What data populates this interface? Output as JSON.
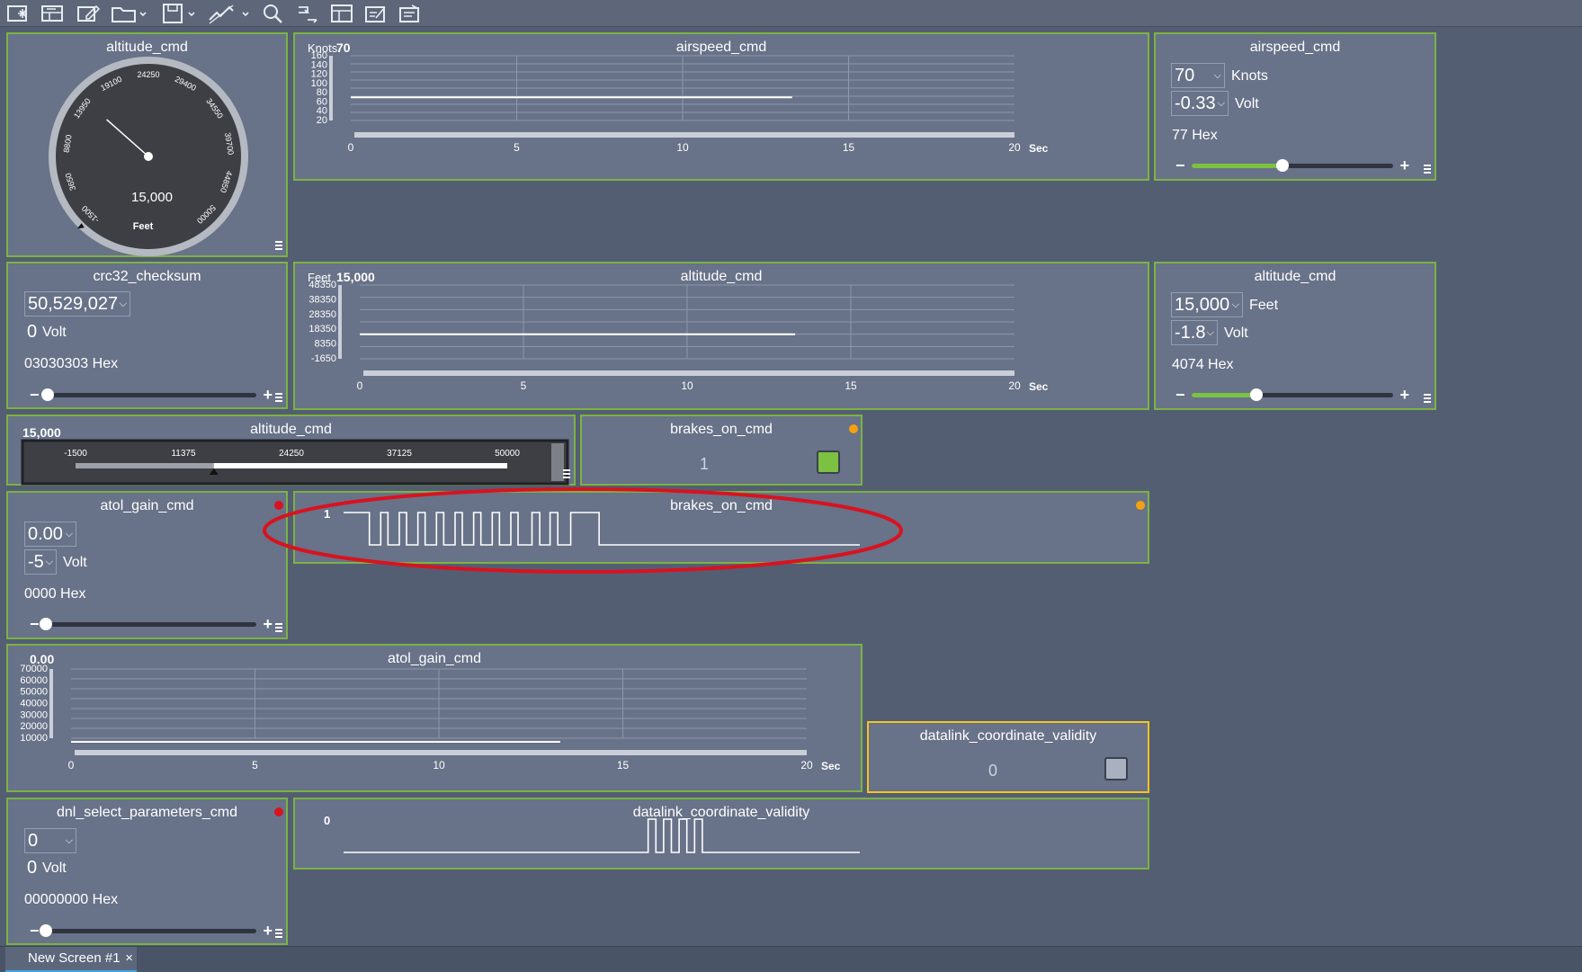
{
  "toolbar": {
    "icons": [
      "new-screen-icon",
      "layout-icon",
      "edit-icon",
      "open-folder-icon",
      "save-icon",
      "signal-icon",
      "search-icon",
      "transfer-icon",
      "table-icon",
      "script-icon",
      "export-icon"
    ]
  },
  "gauge": {
    "title": "altitude_cmd",
    "value_text": "15,000",
    "unit": "Feet",
    "min": -1500,
    "max": 50000,
    "value": 15000,
    "ticks": [
      "-1500",
      "3650",
      "8800",
      "13950",
      "19100",
      "24250",
      "29400",
      "34550",
      "39700",
      "44850",
      "50000"
    ]
  },
  "airspeed_chart": {
    "title": "airspeed_cmd",
    "unit": "Knots",
    "value": "70",
    "sec": "Sec"
  },
  "airspeed_ctrl": {
    "title": "airspeed_cmd",
    "value": "70",
    "unit": "Knots",
    "volt": "-0.33",
    "volt_unit": "Volt",
    "hex": "77 Hex",
    "slider": 0.45
  },
  "crc": {
    "title": "crc32_checksum",
    "value": "50,529,027",
    "volt": "0",
    "volt_unit": "Volt",
    "hex": "03030303 Hex",
    "slider": 0.01
  },
  "alt_chart": {
    "title": "altitude_cmd",
    "unit": "Feet",
    "value": "15,000",
    "sec": "Sec"
  },
  "alt_ctrl": {
    "title": "altitude_cmd",
    "value": "15,000",
    "unit": "Feet",
    "volt": "-1.8",
    "volt_unit": "Volt",
    "hex": "4074 Hex",
    "slider": 0.32
  },
  "alt_bar": {
    "title": "altitude_cmd",
    "value_text": "15,000",
    "min": -1500,
    "max": 50000,
    "value": 15000,
    "ticks": [
      "-1500",
      "11375",
      "24250",
      "37125",
      "50000"
    ]
  },
  "brakes_btn": {
    "title": "brakes_on_cmd",
    "value": "1",
    "led_color": "#7cc142",
    "dot_color": "#f3a10f"
  },
  "atol_ctrl": {
    "title": "atol_gain_cmd",
    "value": "0.00",
    "volt": "-5",
    "volt_unit": "Volt",
    "hex": "0000 Hex",
    "slider": 0.0,
    "dot_color": "#d9121f"
  },
  "brakes_wave": {
    "title": "brakes_on_cmd",
    "value": "1",
    "dot_color": "#f3a10f"
  },
  "atol_chart": {
    "title": "atol_gain_cmd",
    "value": "0.00",
    "sec": "Sec"
  },
  "datalink_btn": {
    "title": "datalink_coordinate_validity",
    "value": "0",
    "led_color": "#a9b0bf"
  },
  "dnl_ctrl": {
    "title": "dnl_select_parameters_cmd",
    "value": "0",
    "volt": "0",
    "volt_unit": "Volt",
    "hex": "00000000 Hex",
    "slider": 0.0,
    "dot_color": "#d9121f"
  },
  "datalink_wave": {
    "title": "datalink_coordinate_validity",
    "value": "0"
  },
  "tab": {
    "label": "New Screen #1",
    "close": "×"
  },
  "chart_data": [
    {
      "type": "line",
      "title": "airspeed_cmd",
      "ylabel": "Knots",
      "xlabel": "Sec",
      "x_ticks": [
        "0",
        "5",
        "10",
        "15",
        "20"
      ],
      "y_ticks": [
        "20",
        "40",
        "60",
        "80",
        "100",
        "120",
        "140",
        "160"
      ],
      "xlim": [
        0,
        20
      ],
      "ylim": [
        20,
        160
      ],
      "series": [
        {
          "x": [
            0,
            13.3
          ],
          "y": [
            70,
            70
          ]
        }
      ]
    },
    {
      "type": "line",
      "title": "altitude_cmd",
      "ylabel": "Feet",
      "xlabel": "Sec",
      "x_ticks": [
        "0",
        "5",
        "10",
        "15",
        "20"
      ],
      "y_ticks": [
        "-1650",
        "8350",
        "18350",
        "28350",
        "38350",
        "48350"
      ],
      "xlim": [
        0,
        20
      ],
      "ylim": [
        -1650,
        48350
      ],
      "series": [
        {
          "x": [
            0,
            13.3
          ],
          "y": [
            15000,
            15000
          ]
        }
      ]
    },
    {
      "type": "line",
      "title": "atol_gain_cmd",
      "xlabel": "Sec",
      "x_ticks": [
        "0",
        "5",
        "10",
        "15",
        "20"
      ],
      "y_ticks": [
        "10000",
        "20000",
        "30000",
        "40000",
        "50000",
        "60000",
        "70000"
      ],
      "xlim": [
        0,
        20
      ],
      "ylim": [
        10000,
        70000
      ],
      "series": [
        {
          "x": [
            0,
            13.3
          ],
          "y": [
            0,
            0
          ]
        }
      ]
    },
    {
      "type": "line",
      "title": "brakes_on_cmd",
      "ylabel": "1",
      "series": [
        {
          "x": [
            0,
            0.05,
            0.05,
            0.072,
            0.072,
            0.086,
            0.086,
            0.108,
            0.108,
            0.122,
            0.122,
            0.144,
            0.144,
            0.158,
            0.158,
            0.18,
            0.18,
            0.194,
            0.194,
            0.216,
            0.216,
            0.23,
            0.23,
            0.252,
            0.252,
            0.266,
            0.266,
            0.288,
            0.288,
            0.302,
            0.302,
            0.324,
            0.324,
            0.338,
            0.338,
            0.365,
            0.365,
            0.38,
            0.38,
            0.4,
            0.4,
            0.415,
            0.415,
            0.44,
            0.44,
            0.495,
            0.495,
            1
          ],
          "y": [
            1,
            1,
            0,
            0,
            1,
            1,
            0,
            0,
            1,
            1,
            0,
            0,
            1,
            1,
            0,
            0,
            1,
            1,
            0,
            0,
            1,
            1,
            0,
            0,
            1,
            1,
            0,
            0,
            1,
            1,
            0,
            0,
            1,
            1,
            0,
            0,
            1,
            1,
            0,
            0,
            1,
            1,
            0,
            0,
            1,
            1,
            0,
            0
          ]
        }
      ]
    },
    {
      "type": "line",
      "title": "datalink_coordinate_validity",
      "ylabel": "0",
      "series": [
        {
          "x": [
            0,
            0.59,
            0.59,
            0.605,
            0.605,
            0.62,
            0.62,
            0.635,
            0.635,
            0.65,
            0.65,
            0.665,
            0.665,
            0.68,
            0.68,
            0.695,
            0.695,
            1
          ],
          "y": [
            0,
            0,
            1,
            1,
            0,
            0,
            1,
            1,
            0,
            0,
            1,
            1,
            0,
            0,
            1,
            1,
            0,
            0
          ]
        }
      ]
    }
  ]
}
